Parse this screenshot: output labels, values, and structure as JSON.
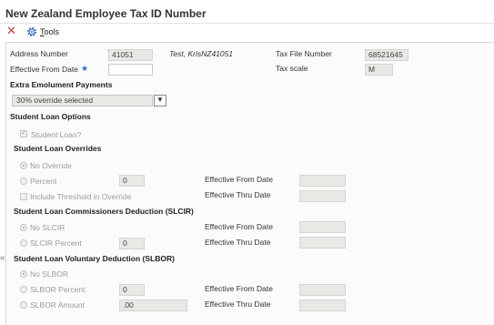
{
  "window": {
    "title": "New Zealand Employee Tax ID Number"
  },
  "toolbar": {
    "close_icon": "x-icon",
    "tools_icon": "gear-icon",
    "tools_label": "Tools",
    "tools_underline_char": "T",
    "tools_rest": "ools"
  },
  "header": {
    "address_number_label": "Address Number",
    "address_number_value": "41051",
    "employee_name": "Test, KrisNZ41051",
    "tax_file_number_label": "Tax File Number",
    "tax_file_number_value": "68521645",
    "effective_from_label": "Effective From Date",
    "tax_scale_label": "Tax scale",
    "tax_scale_value": "M"
  },
  "extra_emolument": {
    "label": "Extra Emolument Payments",
    "selected": "30% override selected"
  },
  "student_loan_options": {
    "label": "Student Loan Options",
    "student_loan_label": "Student Loan?",
    "student_loan_checked": true
  },
  "student_loan_overrides": {
    "label": "Student Loan Overrides",
    "no_override": "No Override",
    "percent": "Percent",
    "percent_value": "0",
    "include_threshold": "Include Threshold in Override",
    "effective_from": "Effective From Date",
    "effective_thru": "Effective Thru Date"
  },
  "slcir": {
    "label": "Student Loan Commissioners Deduction (SLCIR)",
    "no_slcir": "No SLCIR",
    "slcir_percent": "SLCIR Percent",
    "percent_value": "0",
    "effective_from": "Effective From Date",
    "effective_thru": "Effective Thru Date"
  },
  "slbor": {
    "label": "Student Loan Voluntary Deduction (SLBOR)",
    "no_slbor": "No SLBOR",
    "slbor_percent": "SLBOR Percent",
    "percent_value": "0",
    "slbor_amount": "SLBOR Amount",
    "amount_value": ".00",
    "effective_from": "Effective From Date",
    "effective_thru": "Effective Thru Date"
  },
  "colors": {
    "close": "#d43a2a",
    "accent": "#2a6fc9",
    "required": "#e07020"
  }
}
